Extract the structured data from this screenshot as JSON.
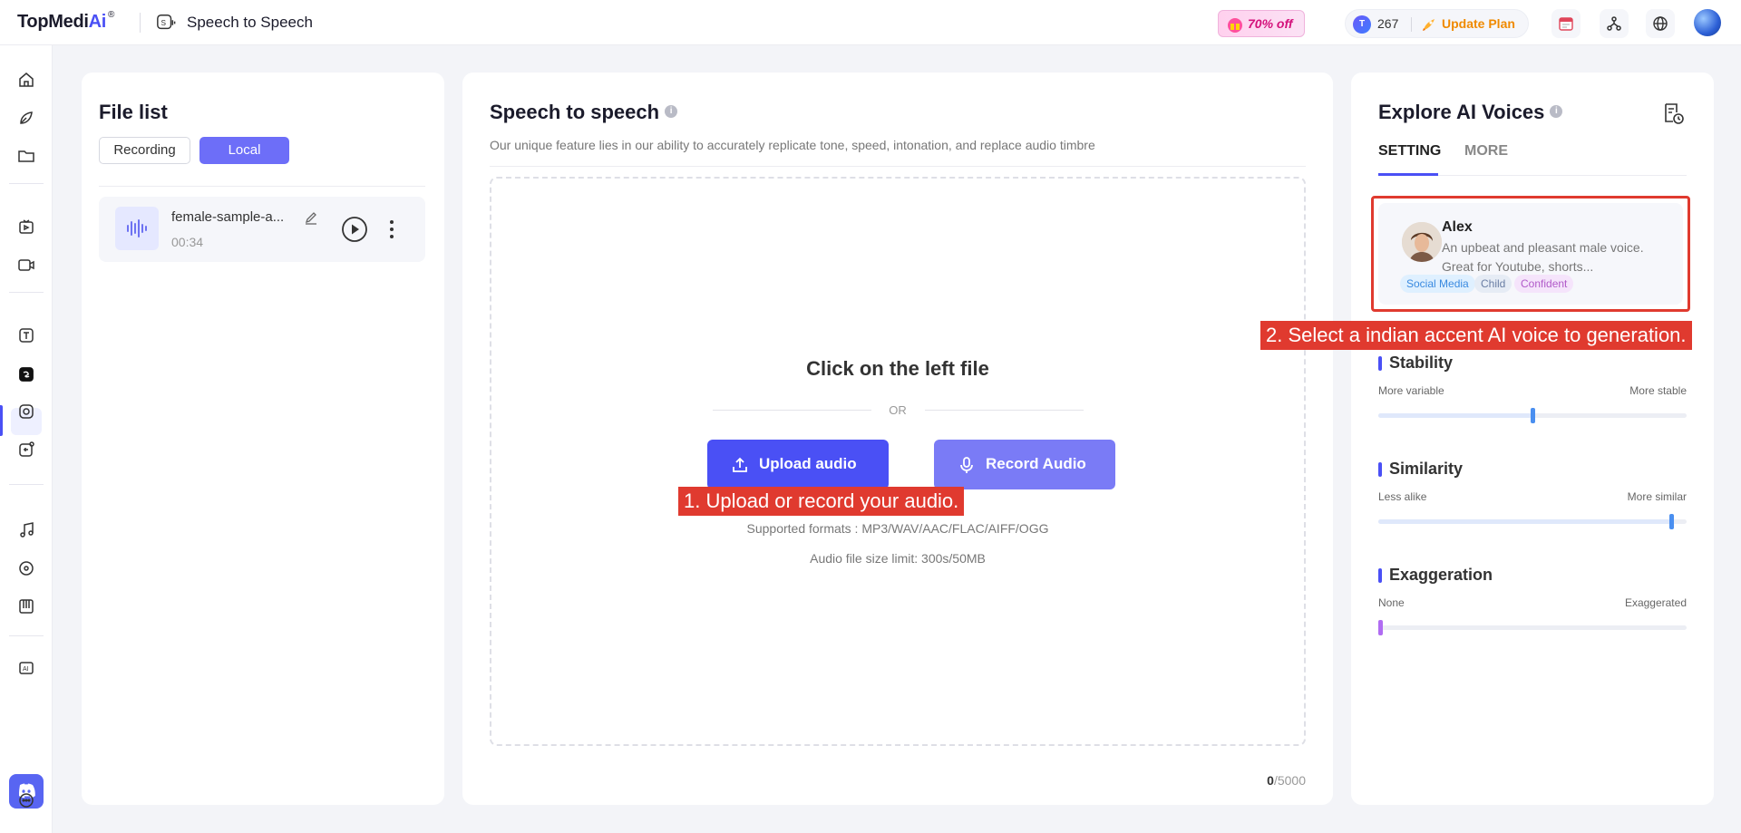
{
  "app": {
    "logo_text": "TopMedi",
    "logo_ai": "Ai",
    "logo_reg": "®",
    "page_title": "Speech to Speech",
    "promo": "70% off",
    "credits": "267",
    "update_plan": "Update Plan"
  },
  "file_list": {
    "title": "File list",
    "tabs": [
      "Recording",
      "Local"
    ],
    "active_tab": "Local",
    "files": [
      {
        "name": "female-sample-a...",
        "duration": "00:34"
      }
    ]
  },
  "main": {
    "title": "Speech to speech",
    "subtitle": "Our unique feature lies in our ability to accurately replicate tone, speed, intonation, and replace audio timbre",
    "drop_title": "Click on the left file",
    "or": "OR",
    "upload_label": "Upload audio",
    "record_label": "Record Audio",
    "formats": "Supported formats : MP3/WAV/AAC/FLAC/AIFF/OGG",
    "size_limit": "Audio file size limit: 300s/50MB",
    "counter_used": "0",
    "counter_max": "/5000"
  },
  "voices": {
    "title": "Explore AI Voices",
    "tabs": [
      "SETTING",
      "MORE"
    ],
    "active_tab": "SETTING",
    "voice": {
      "name": "Alex",
      "description": "An upbeat and pleasant male voice. Great for Youtube, shorts...",
      "tags": [
        "Social Media",
        "Child",
        "Confident"
      ]
    },
    "sliders": [
      {
        "title": "Stability",
        "left_label": "More variable",
        "right_label": "More stable",
        "value": 0.5
      },
      {
        "title": "Similarity",
        "left_label": "Less alike",
        "right_label": "More similar",
        "value": 0.95
      },
      {
        "title": "Exaggeration",
        "left_label": "None",
        "right_label": "Exaggerated",
        "value": 0.0
      }
    ]
  },
  "annotations": {
    "step1": "1. Upload or record your audio.",
    "step2": "2. Select a indian accent AI voice to generation."
  },
  "colors": {
    "accent": "#4a50f5",
    "annotation": "#e03a2f",
    "plan": "#f08a00"
  }
}
